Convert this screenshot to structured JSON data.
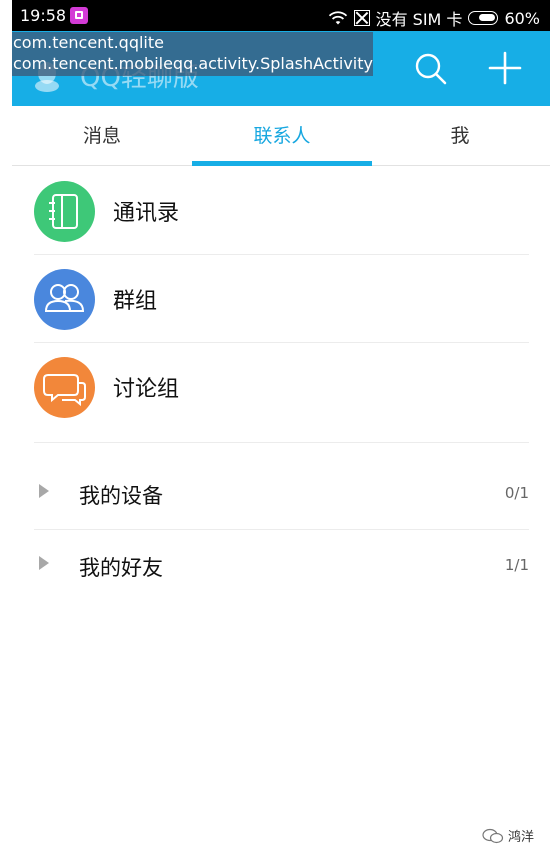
{
  "status_bar": {
    "time": "19:58",
    "carrier": "没有 SIM 卡",
    "battery": "60%",
    "icons": [
      "app-notification-icon",
      "wifi-icon",
      "no-sim-icon",
      "battery-icon"
    ]
  },
  "header": {
    "title": "QQ轻聊版",
    "debug_package": "com.tencent.qqlite",
    "debug_activity": "com.tencent.mobileqq.activity.SplashActivity",
    "background_color": "#17aee6",
    "icons": [
      "qq-logo-icon",
      "search-icon",
      "plus-icon"
    ]
  },
  "tabs": [
    {
      "label": "消息",
      "active": false
    },
    {
      "label": "联系人",
      "active": true
    },
    {
      "label": "我",
      "active": false
    }
  ],
  "contacts": [
    {
      "label": "通讯录",
      "icon": "address-book-icon",
      "color": "#3ec878"
    },
    {
      "label": "群组",
      "icon": "group-icon",
      "color": "#4a87dd"
    },
    {
      "label": "讨论组",
      "icon": "chat-bubbles-icon",
      "color": "#f2873a"
    }
  ],
  "groups": [
    {
      "label": "我的设备",
      "count": "0/1"
    },
    {
      "label": "我的好友",
      "count": "1/1"
    }
  ],
  "watermark": {
    "text": "鸿洋"
  },
  "colors": {
    "accent": "#17aee6",
    "active_tab_text": "#17a7e0"
  }
}
